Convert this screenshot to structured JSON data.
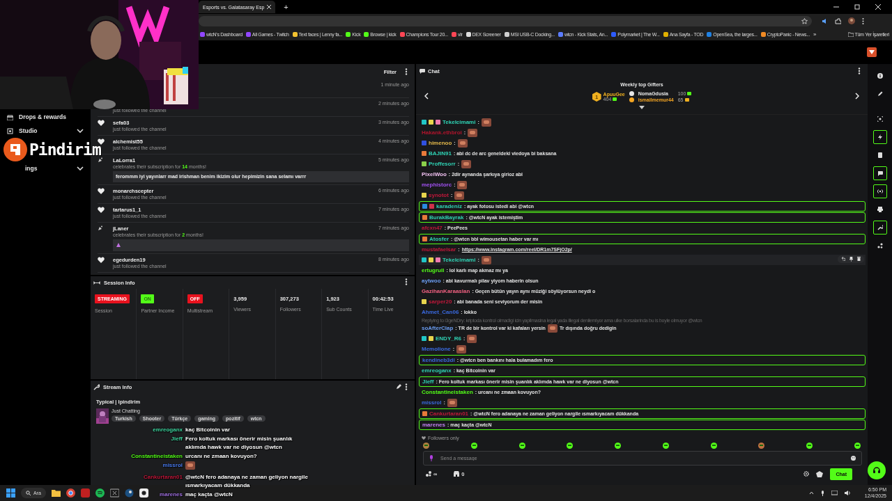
{
  "browser": {
    "tab": {
      "title": "Esports vs. Galatasaray Esp",
      "selected": true
    },
    "new_tab": "+",
    "bookmarks": [
      {
        "label": "wtcN's Dashboard",
        "color": "#9146ff"
      },
      {
        "label": "All Games - Twitch",
        "color": "#9146ff"
      },
      {
        "label": "Text faces | Lenny fa...",
        "color": "#f2c230"
      },
      {
        "label": "Kick",
        "color": "#53fc18"
      },
      {
        "label": "Browse | kick",
        "color": "#53fc18"
      },
      {
        "label": "Champions Tour 20...",
        "color": "#ff4655"
      },
      {
        "label": "vlr",
        "color": "#ff4655"
      },
      {
        "label": "DEX Screener",
        "color": "#dddddd"
      },
      {
        "label": "MSI USB-C Docking...",
        "color": "#cfcfcf"
      },
      {
        "label": "wtcn - Kick Stats, An...",
        "color": "#5b7cff"
      },
      {
        "label": "Polymarket | The W...",
        "color": "#2e5cff"
      },
      {
        "label": "Ana Sayfa - TOD",
        "color": "#e0b000"
      },
      {
        "label": "OpenSea, the larges...",
        "color": "#2081e2"
      },
      {
        "label": "CryptoPanic - News...",
        "color": "#f08a24"
      }
    ],
    "more": "»",
    "all_bookmarks": "Tüm Yer İşaretleri"
  },
  "sidebar": {
    "items": [
      {
        "label": "Drops & rewards",
        "expandable": false
      },
      {
        "label": "Studio",
        "expandable": true
      },
      {
        "label": "ings",
        "expandable": true
      }
    ]
  },
  "feed": {
    "filter": "Filter",
    "items": [
      {
        "kind": "follow",
        "time": "1 minute ago"
      },
      {
        "kind": "follow",
        "text": "just followed the channel",
        "time": "2 minutes ago"
      },
      {
        "kind": "follow",
        "user": "sefa03",
        "text": "just followed the channel",
        "time": "3 minutes ago"
      },
      {
        "kind": "follow",
        "user": "alchemist55",
        "text": "just followed the channel",
        "time": "4 minutes ago"
      },
      {
        "kind": "sub",
        "user": "LaLorra1",
        "text": "celebrates their subscription for **14** months!",
        "message": "ferommm iyi yayınlarr mad irishman benim ikizim olur hepimizin sana selamı varrr",
        "time": "5 minutes ago"
      },
      {
        "kind": "follow",
        "user": "monarchscepter",
        "text": "just followed the channel",
        "time": "6 minutes ago"
      },
      {
        "kind": "follow",
        "user": "tartarus1_1",
        "text": "just followed the channel",
        "time": "7 minutes ago"
      },
      {
        "kind": "sub",
        "user": "jLaner",
        "text": "celebrates their subscription for **2** months!",
        "message_emote": true,
        "time": "7 minutes ago"
      },
      {
        "kind": "follow",
        "user": "egedurden19",
        "text": "just followed the channel",
        "time": "8 minutes ago"
      }
    ]
  },
  "session": {
    "title": "Session Info",
    "stats": [
      {
        "kind": "badge",
        "badge": "STREAMING",
        "color": "#e8121e",
        "label": "Session"
      },
      {
        "kind": "badge",
        "badge": "ON",
        "color": "#53fc18",
        "label": "Partner Income"
      },
      {
        "kind": "badge",
        "badge": "OFF",
        "color": "#e8121e",
        "label": "Multistream"
      },
      {
        "kind": "value",
        "value": "3,959",
        "label": "Viewers"
      },
      {
        "kind": "value",
        "value": "307,273",
        "label": "Followers"
      },
      {
        "kind": "value",
        "value": "1,923",
        "label": "Sub Counts"
      },
      {
        "kind": "value",
        "value": "00:42:53",
        "label": "Time Live"
      }
    ]
  },
  "stream_info": {
    "title": "Stream Info",
    "stream_title": "Typical | Ipindirim",
    "category": "Just Chatting",
    "tags": [
      "Turkish",
      "Shooter",
      "Türkçe",
      "gaming",
      "pozitif",
      "wtcn"
    ]
  },
  "chat": {
    "title": "Chat",
    "gifters": {
      "title": "Weekly top Gifters",
      "top": {
        "rank": "1",
        "user": "ApuuGee",
        "amount": "404"
      },
      "others": [
        {
          "user": "NomaGdusia",
          "amount": "100",
          "color": "#e6e6e6"
        },
        {
          "user": "ismailmemur44",
          "amount": "65",
          "color": "#f5a623"
        }
      ]
    },
    "messages": [
      {
        "kind": "emote",
        "user": "Tekelcimami",
        "color": "#2fd3b5",
        "text": ":",
        "badges": [
          {
            "color": "#21c6c6"
          },
          {
            "color": "#e8d44d"
          },
          {
            "color": "#f07ab0"
          }
        ],
        "highlighted": false,
        "hovered": false
      },
      {
        "kind": "emote",
        "user": "Hakank.ethbroi",
        "color": "#b0142c",
        "text": ":",
        "highlighted": false,
        "hovered": false
      },
      {
        "kind": "emote",
        "user": "himenoo",
        "color": "#e3b84a",
        "text": ":",
        "badges": [
          {
            "color": "#3050e0"
          }
        ],
        "highlighted": false,
        "hovered": false
      },
      {
        "kind": "text",
        "user": "BAJIN91",
        "color": "#2fd3b5",
        "text": ": abi dc de arc geneldeki viedoya bi baksana",
        "badges": [
          {
            "color": "#e87a3a"
          }
        ],
        "highlighted": false,
        "hovered": false
      },
      {
        "kind": "emote",
        "user": "Proffesorr",
        "color": "#2fd3b5",
        "text": ":",
        "badges": [
          {
            "color": "#8ad04a"
          }
        ],
        "highlighted": false,
        "hovered": false
      },
      {
        "kind": "text",
        "user": "PixelWoo",
        "color": "#f0c0f0",
        "text": ": 2dir aynanda şarkıya girioz abi",
        "highlighted": false,
        "hovered": false
      },
      {
        "kind": "emote",
        "user": "mephistorc",
        "color": "#a050f0",
        "text": ":",
        "highlighted": false,
        "hovered": false
      },
      {
        "kind": "emote",
        "user": "synotot",
        "color": "#c0183a",
        "text": ":",
        "badges": [
          {
            "color": "#e8d44d"
          }
        ],
        "highlighted": false,
        "hovered": false
      },
      {
        "kind": "text",
        "user": "karadeniz",
        "color": "#2fd3b5",
        "text": ": ayak fotosu istedi abi @wtcn",
        "badges": [
          {
            "color": "#2a8ae0"
          },
          {
            "color": "#d0304a"
          }
        ],
        "highlighted": true,
        "hovered": false
      },
      {
        "kind": "text",
        "user": "BurakBayrak",
        "color": "#2fd3b5",
        "text": ": @wtcN ayak istemiştim",
        "badges": [
          {
            "color": "#e87a3a"
          }
        ],
        "highlighted": true,
        "hovered": false
      },
      {
        "kind": "text",
        "user": "afcxn47",
        "color": "#c0183a",
        "text": ": PeePees",
        "highlighted": false,
        "hovered": false
      },
      {
        "kind": "text",
        "user": "Atosfer",
        "color": "#2fd3b5",
        "text": ": @wtcn bbl wimousetan haber var mı",
        "badges": [
          {
            "color": "#e87a3a"
          }
        ],
        "highlighted": true,
        "hovered": false
      },
      {
        "kind": "link",
        "user": "mustafaelsar",
        "color": "#c0183a",
        "text": ": ",
        "link": "https://www.instagram.com/reel/DR1m7SFjO2p/",
        "highlighted": false,
        "hovered": false
      },
      {
        "kind": "emote",
        "user": "Tekelcimami",
        "color": "#2fd3b5",
        "text": ":",
        "badges": [
          {
            "color": "#21c6c6"
          },
          {
            "color": "#e8d44d"
          },
          {
            "color": "#f07ab0"
          }
        ],
        "highlighted": false,
        "hovered": true
      },
      {
        "kind": "text",
        "user": "ertugrull",
        "color": "#53fc18",
        "text": ": lol karlı map akmaz mı ya",
        "highlighted": false,
        "hovered": false
      },
      {
        "kind": "text",
        "user": "aytwoo",
        "color": "#6a9cf0",
        "text": ": abi kavurmalı pilav yiyom haberin olsun",
        "highlighted": false,
        "hovered": false
      },
      {
        "kind": "text",
        "user": "GazihanKaraaslan",
        "color": "#f06080",
        "text": ": Geçen bütün yayın aynı müziği söylüyorsun neydi o",
        "highlighted": false,
        "hovered": false
      },
      {
        "kind": "text",
        "user": "sarper20",
        "color": "#c0183a",
        "text": ": abi banada seni seviyorum der misin",
        "badges": [
          {
            "color": "#e8d44d"
          }
        ],
        "highlighted": false,
        "hovered": false
      },
      {
        "kind": "text",
        "user": "Ahmet_Can06",
        "color": "#3a6ae0",
        "text": ": lokko",
        "highlighted": false,
        "hovered": false
      },
      {
        "kind": "mixed",
        "user": "soAfterClap",
        "color": "#6a9cf0",
        "reply": "Replying to i3geNDry: kriptoda kontrol olmadigi icin yapilmasina legal yada illegal denilemiyor ama ulke borsalarinda bu is boyle olmuyor @wtcn",
        "text": ": TR de bir kontrol var ki kafaları yersin",
        "text_after": "Tr dışında doğru dedigin",
        "highlighted": false,
        "hovered": false
      },
      {
        "kind": "emote",
        "user": "ENDY_R6",
        "color": "#2fd3b5",
        "text": ":",
        "badges": [
          {
            "color": "#21c6c6"
          },
          {
            "color": "#e8d44d"
          }
        ],
        "highlighted": false,
        "hovered": false
      },
      {
        "kind": "emote",
        "user": "Memolione",
        "color": "#3a6ae0",
        "text": ":",
        "highlighted": false,
        "hovered": false
      },
      {
        "kind": "text",
        "user": "kendineb3di",
        "color": "#3a6ae0",
        "text": ": @wtcn ben bankını hala bulamadım fero",
        "highlighted": true,
        "hovered": false
      },
      {
        "kind": "text",
        "user": "emreoganx",
        "color": "#2fd3b5",
        "text": ": kaç Bitcoinin var",
        "highlighted": false,
        "hovered": false
      },
      {
        "kind": "text",
        "user": "Jieff",
        "color": "#2fd3b5",
        "text": ": Fero koltuk markası önerir misin şuanlık aklımda hawk var ne diyosun @wtcn",
        "highlighted": true,
        "hovered": false
      },
      {
        "kind": "text",
        "user": "Constantineistaken",
        "color": "#53fc18",
        "text": ": urcanı ne zmaan kovuyon?",
        "highlighted": false,
        "hovered": false
      },
      {
        "kind": "emote",
        "user": "missrol",
        "color": "#3a6ae0",
        "text": ":",
        "highlighted": false,
        "hovered": false
      },
      {
        "kind": "text",
        "user": "Cankurtaran01",
        "color": "#c0183a",
        "text": ": @wtcN fero adanaya ne zaman geliyon nargile ısmarkıyacam dükkanda",
        "badges": [
          {
            "color": "#e87a3a"
          }
        ],
        "highlighted": true,
        "hovered": false
      },
      {
        "kind": "text",
        "user": "marenes",
        "color": "#c080f0",
        "text": ": maç kaçta @wtcN",
        "highlighted": true,
        "hovered": false
      }
    ],
    "followers_only": "Followers only",
    "input": {
      "placeholder": "Send a message"
    },
    "points": "∞",
    "store_count": "0",
    "send": "Chat"
  },
  "rail": {
    "items": [
      {
        "outlined": false
      },
      {
        "outlined": false
      },
      {
        "outlined": false
      },
      {
        "outlined": true
      },
      {
        "outlined": false
      },
      {
        "outlined": true
      },
      {
        "outlined": true
      },
      {
        "outlined": false
      },
      {
        "outlined": true
      },
      {
        "outlined": false
      }
    ]
  },
  "overlay": {
    "logo": "Pindirim",
    "chat": [
      {
        "kind": "text",
        "user": "emreoganx",
        "color": "#3fd6a0",
        "text": "kaç Bitcoinin var"
      },
      {
        "kind": "text",
        "user": "Jieff",
        "color": "#3fd6a0",
        "text": "Fero koltuk markası önerir misin şuanlık aklımda hawk var ne diyosun @wtcn"
      },
      {
        "kind": "text",
        "user": "Constantineistaken",
        "color": "#53fc18",
        "text": "urcanı ne zmaan kovuyon?"
      },
      {
        "kind": "emote",
        "user": "missrol",
        "color": "#4a7cf0"
      },
      {
        "kind": "text",
        "user": "Cankurtaran01",
        "color": "#c0183a",
        "text": "@wtcN fero adanaya ne zaman geliyon nargile ısmarkıyacam dükkanda"
      },
      {
        "kind": "text",
        "user": "marenes",
        "color": "#a070e0",
        "text": "maç kaçta @wtcN"
      }
    ]
  },
  "taskbar": {
    "search": "Ara",
    "time": "6:50 PM",
    "date": "12/4/2025"
  }
}
